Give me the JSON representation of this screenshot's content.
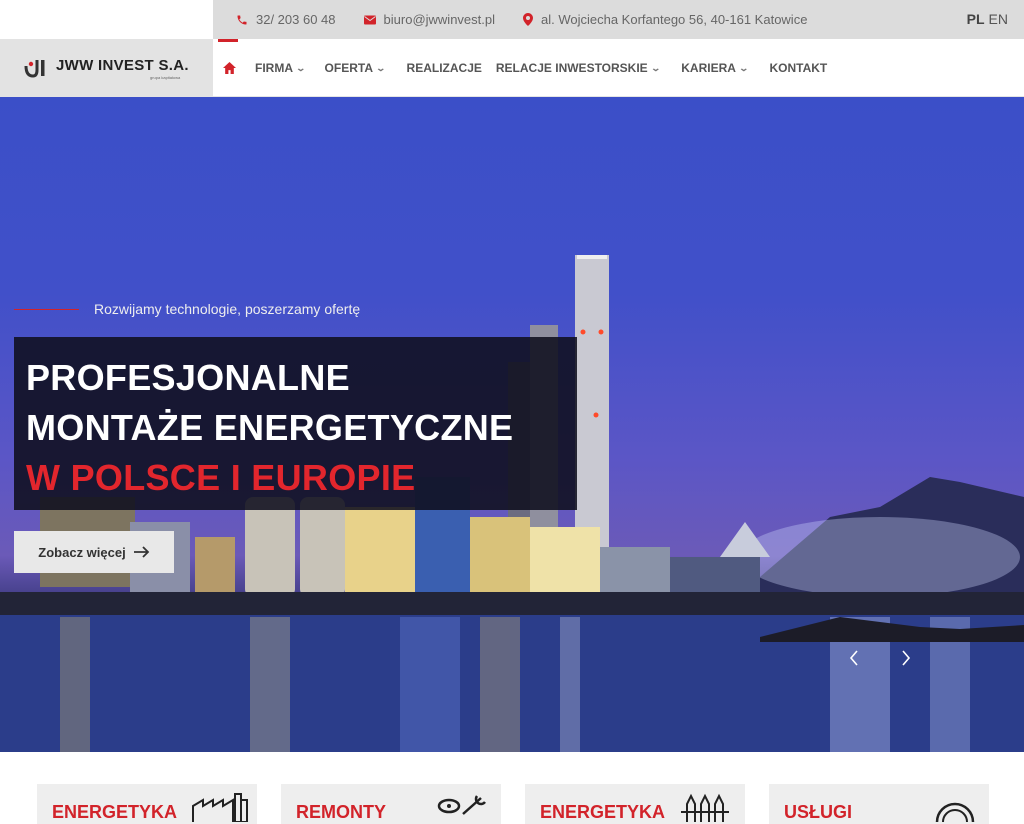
{
  "topbar": {
    "phone": "32/ 203 60 48",
    "email": "biuro@jwwinvest.pl",
    "address": "al. Wojciecha Korfantego 56, 40-161 Katowice",
    "lang_pl": "PL",
    "lang_en": "EN"
  },
  "logo": {
    "mark": "JI",
    "name": "JWW INVEST S.A.",
    "sub": "grupa kapitałowa"
  },
  "nav": {
    "items": [
      {
        "label": "FIRMA",
        "has_dropdown": true
      },
      {
        "label": "OFERTA",
        "has_dropdown": true
      },
      {
        "label": "REALIZACJE",
        "has_dropdown": false
      },
      {
        "label": "RELACJE INWESTORSKIE",
        "has_dropdown": true
      },
      {
        "label": "KARIERA",
        "has_dropdown": true
      },
      {
        "label": "KONTAKT",
        "has_dropdown": false
      }
    ]
  },
  "hero": {
    "tagline": "Rozwijamy technologie, poszerzamy ofertę",
    "line1": "PROFESJONALNE",
    "line2": "MONTAŻE ENERGETYCZNE",
    "line3": "W POLSCE I EUROPIE",
    "cta": "Zobacz więcej"
  },
  "cards": [
    {
      "title": "ENERGETYKA",
      "icon": "factory-icon"
    },
    {
      "title": "REMONTY",
      "icon": "tools-icon"
    },
    {
      "title": "ENERGETYKA",
      "icon": "cylinders-icon"
    },
    {
      "title": "USŁUGI",
      "icon": "circle-icon"
    }
  ],
  "colors": {
    "accent": "#d2232a",
    "topbar_bg": "#dcdcdc",
    "logo_bg": "#e3e3e3"
  }
}
